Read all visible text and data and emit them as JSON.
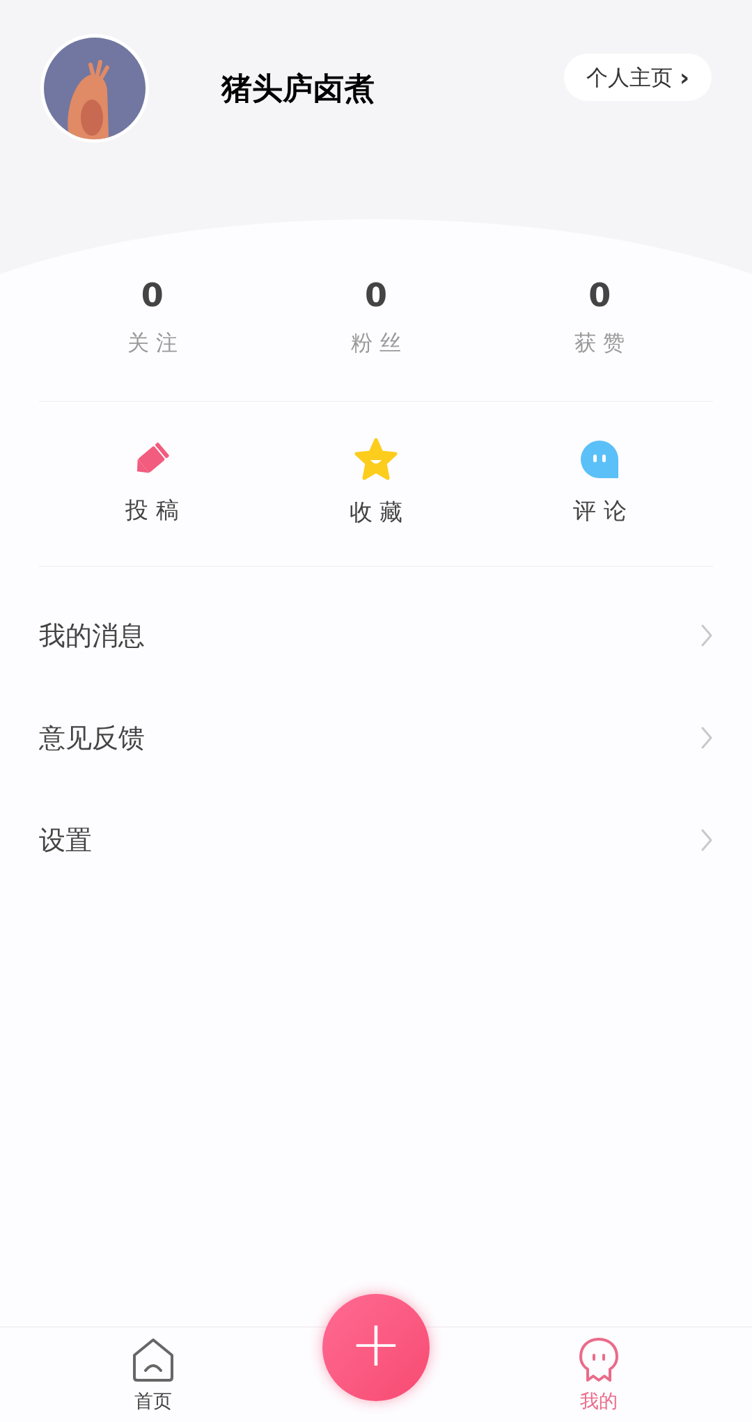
{
  "profile": {
    "name": "猪头庐卤煮",
    "homepage_button": "个人主页",
    "homepage_chevron": "›"
  },
  "stats": [
    {
      "value": "0",
      "label": "关 注"
    },
    {
      "value": "0",
      "label": "粉 丝"
    },
    {
      "value": "0",
      "label": "获 赞"
    }
  ],
  "shortcuts": [
    {
      "kind": "pencil",
      "label": "投 稿"
    },
    {
      "kind": "star",
      "label": "收 藏"
    },
    {
      "kind": "bubble",
      "label": "评 论"
    }
  ],
  "menu": [
    {
      "label": "我的消息"
    },
    {
      "label": "意见反馈"
    },
    {
      "label": "设置"
    }
  ],
  "tab_bar": {
    "tabs": [
      {
        "kind": "home",
        "label": "首页",
        "selected": false
      },
      {
        "kind": "mine",
        "label": "我的",
        "selected": true
      }
    ],
    "add_button": "+"
  }
}
